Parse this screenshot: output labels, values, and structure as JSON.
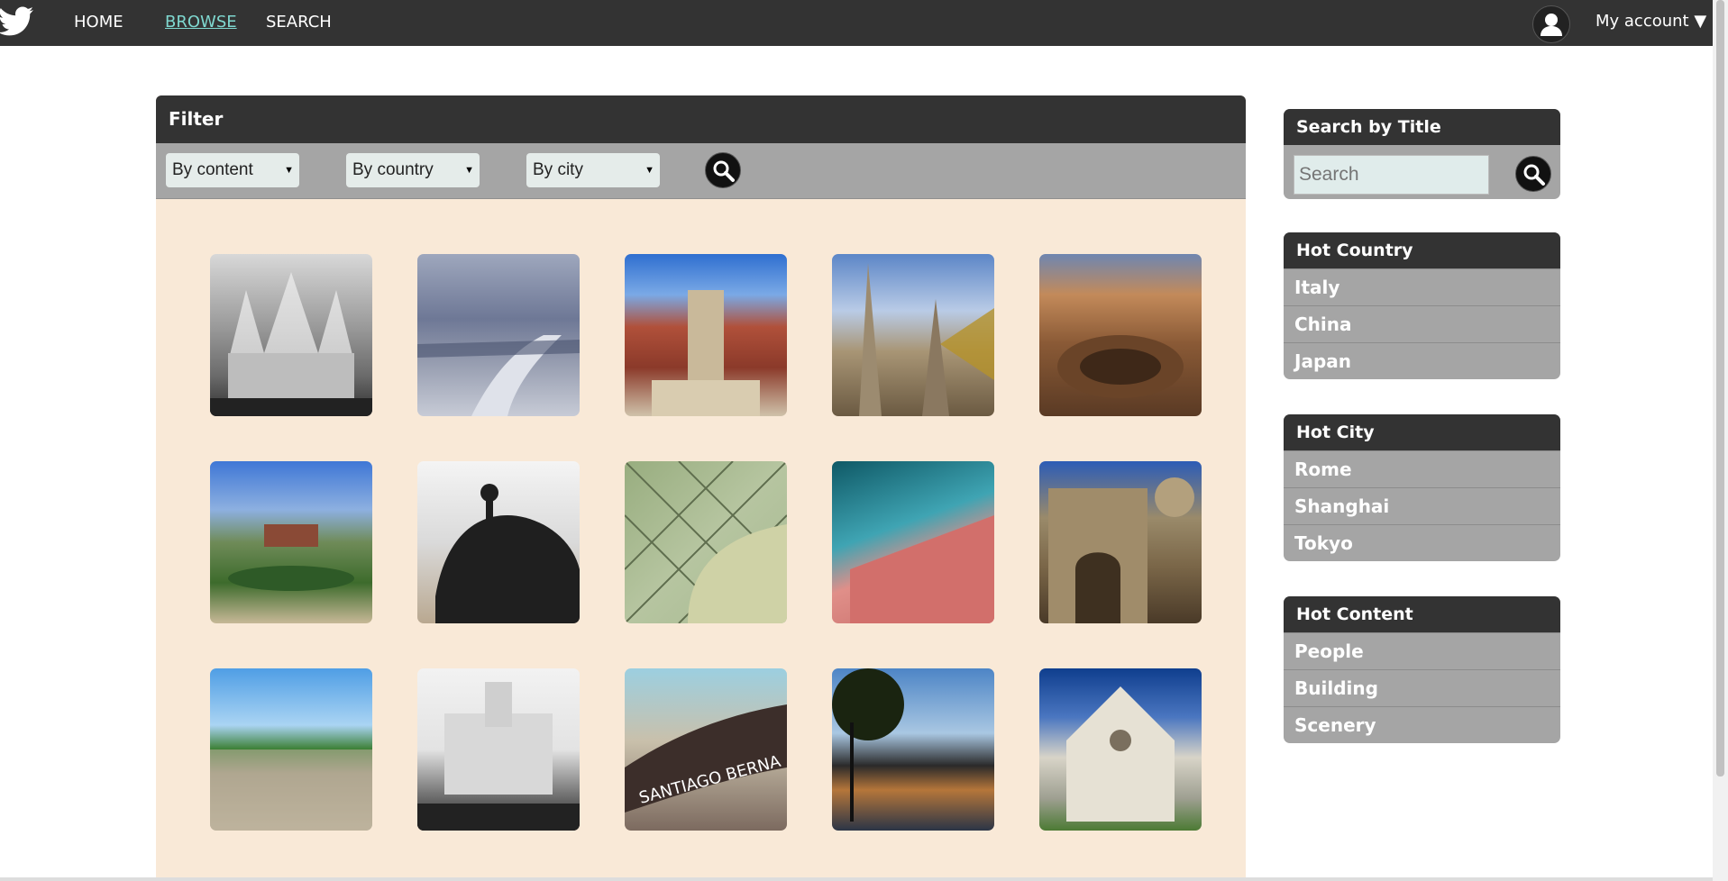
{
  "topbar": {
    "nav": [
      "HOME",
      "BROWSE",
      "SEARCH"
    ],
    "active": "BROWSE",
    "account_label": "My account ▼"
  },
  "filter": {
    "title": "Filter",
    "selects": [
      "By content",
      "By country",
      "By city"
    ]
  },
  "gallery": {
    "images": [
      "cathedral-bw",
      "snowy-park-road",
      "royal-albert-hall",
      "gothic-church",
      "colosseum-interior",
      "palace-garden-fountain",
      "horse-statue-silhouette",
      "glass-roof-museum",
      "arsenal-stadium-sign",
      "roman-arch-ruins",
      "tropical-beach",
      "white-palace-building",
      "santiago-bernabeu-stadium",
      "lakeside-sunset",
      "florence-church-facade"
    ]
  },
  "sidebar": {
    "search": {
      "title": "Search by Title",
      "placeholder": "Search"
    },
    "hot_country": {
      "title": "Hot Country",
      "items": [
        "Italy",
        "China",
        "Japan"
      ]
    },
    "hot_city": {
      "title": "Hot City",
      "items": [
        "Rome",
        "Shanghai",
        "Tokyo"
      ]
    },
    "hot_content": {
      "title": "Hot Content",
      "items": [
        "People",
        "Building",
        "Scenery"
      ]
    }
  },
  "colors": {
    "topbar": "#333333",
    "active_link": "#7fd8d0",
    "panel_gray": "#a5a5a5",
    "gallery_bg": "#f9e9d7"
  }
}
